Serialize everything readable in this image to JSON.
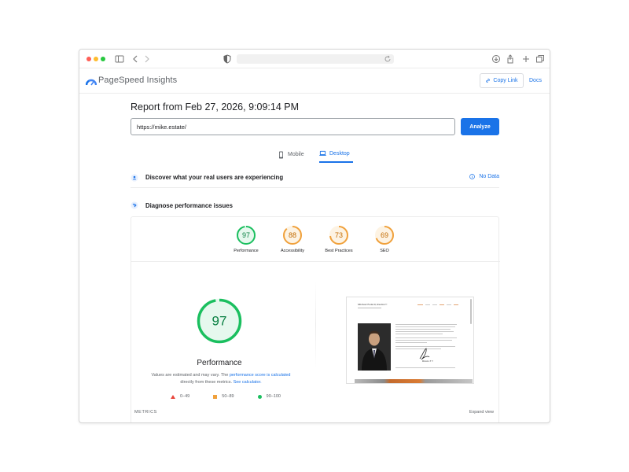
{
  "app": {
    "title": "PageSpeed Insights",
    "copy_link": "Copy Link",
    "docs": "Docs"
  },
  "report": {
    "title": "Report from Feb 27, 2026, 9:09:14 PM",
    "url_value": "https://mike.estate/",
    "analyze": "Analyze"
  },
  "tabs": [
    {
      "label": "Mobile",
      "active": false
    },
    {
      "label": "Desktop",
      "active": true
    }
  ],
  "sections": {
    "real_users": "Discover what your real users are experiencing",
    "no_data": "No Data",
    "diagnose": "Diagnose performance issues"
  },
  "scores": [
    {
      "label": "Performance",
      "value": 97,
      "color": "#1bbf5f"
    },
    {
      "label": "Accessibility",
      "value": 88,
      "color": "#f0a13c"
    },
    {
      "label": "Best Practices",
      "value": 73,
      "color": "#f0a13c"
    },
    {
      "label": "SEO",
      "value": 69,
      "color": "#f0a13c"
    }
  ],
  "performance": {
    "score": 97,
    "title": "Performance",
    "note_1": "Values are estimated and may vary. The ",
    "note_link_1": "performance score is calculated",
    "note_2": " directly from these metrics. ",
    "note_link_2": "See calculator.",
    "legend": [
      {
        "shape": "triangle",
        "label": "0–49",
        "color": "#e8453c"
      },
      {
        "shape": "square",
        "label": "50–89",
        "color": "#f0a13c"
      },
      {
        "shape": "circle",
        "label": "90–100",
        "color": "#1bbf5f"
      }
    ]
  },
  "metrics": {
    "label": "METRICS",
    "expand": "Expand view"
  },
  "thumbnail": {
    "site_name": "Michael Fedacil, Realtor®",
    "realty_text": "REALTY"
  }
}
